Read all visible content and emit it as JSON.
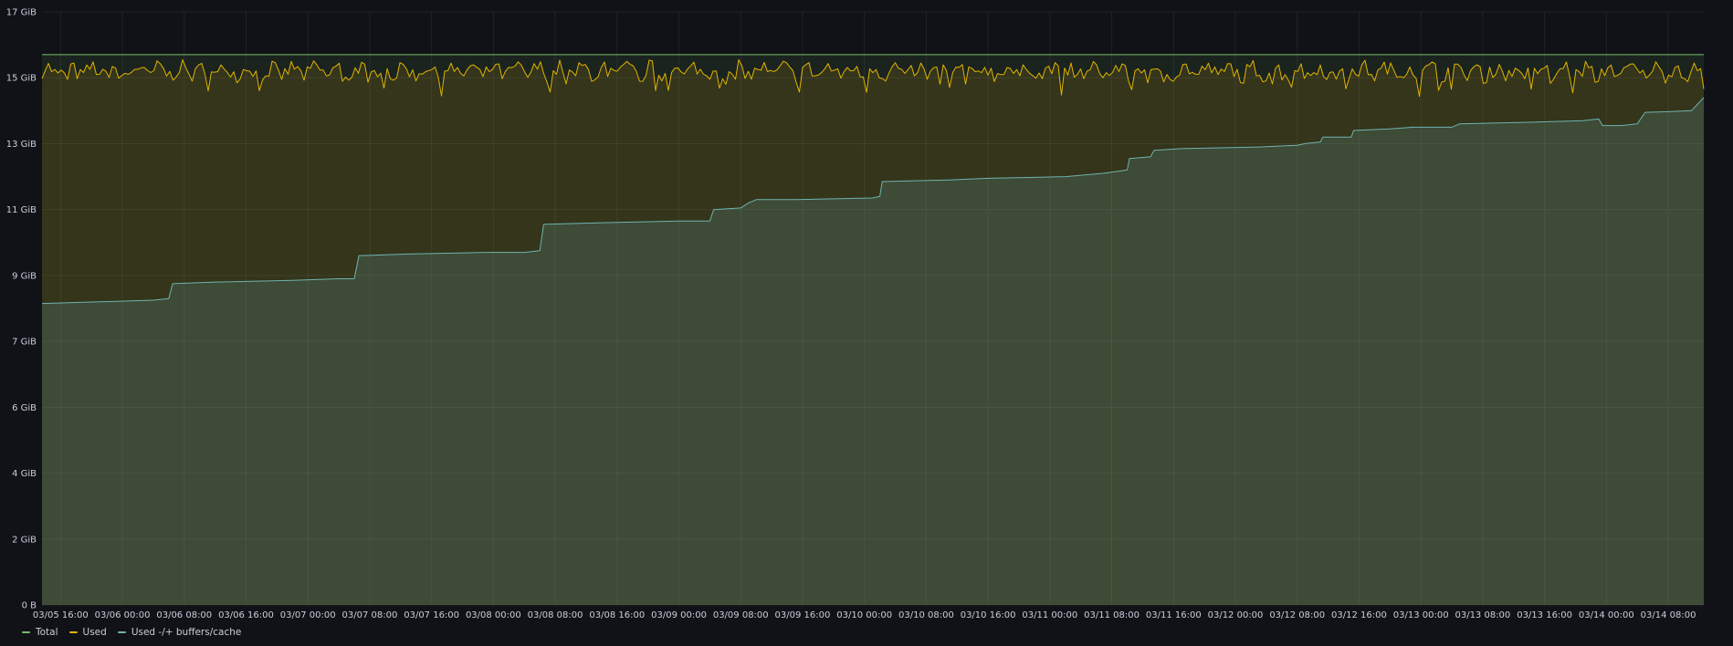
{
  "chart_data": {
    "type": "area",
    "ylim": [
      0,
      17
    ],
    "y_ticks": [
      {
        "label": "0 B",
        "value": 0
      },
      {
        "label": "2 GiB",
        "value": 2
      },
      {
        "label": "4 GiB",
        "value": 4
      },
      {
        "label": "6 GiB",
        "value": 6
      },
      {
        "label": "7 GiB",
        "value": 8
      },
      {
        "label": "9 GiB",
        "value": 10
      },
      {
        "label": "11 GiB",
        "value": 12
      },
      {
        "label": "13 GiB",
        "value": 14
      },
      {
        "label": "15 GiB",
        "value": 16
      },
      {
        "label": "17 GiB",
        "value": 18
      }
    ],
    "x_labels": [
      "03/05 16:00",
      "03/06 00:00",
      "03/06 08:00",
      "03/06 16:00",
      "03/07 00:00",
      "03/07 08:00",
      "03/07 16:00",
      "03/08 00:00",
      "03/08 08:00",
      "03/08 16:00",
      "03/09 00:00",
      "03/09 08:00",
      "03/09 16:00",
      "03/10 00:00",
      "03/10 08:00",
      "03/10 16:00",
      "03/11 00:00",
      "03/11 08:00",
      "03/11 16:00",
      "03/12 00:00",
      "03/12 08:00",
      "03/12 16:00",
      "03/13 00:00",
      "03/13 08:00",
      "03/13 16:00",
      "03/14 00:00",
      "03/14 08:00"
    ],
    "x_start_hours": -2.4,
    "x_end_hours": 212.6,
    "grid": true,
    "legend_position": "bottom-left",
    "series": [
      {
        "name": "Total",
        "color": "#73bf69",
        "fill": "rgba(115,191,105,0.10)",
        "points": [
          [
            -2.4,
            16.7
          ],
          [
            212.6,
            16.7
          ]
        ]
      },
      {
        "name": "Used",
        "color": "#e0b400",
        "fill": "rgba(224,180,0,0.13)",
        "noise_base": 16.2,
        "noise_amp": 0.28,
        "noise_dip": 0.45
      },
      {
        "name": "Used -/+ buffers/cache",
        "color": "#6fb3b0",
        "fill": "rgba(111,179,176,0.18)",
        "points": [
          [
            -2.4,
            9.15
          ],
          [
            5,
            9.2
          ],
          [
            12,
            9.25
          ],
          [
            14,
            9.3
          ],
          [
            14.5,
            9.75
          ],
          [
            20,
            9.8
          ],
          [
            30,
            9.85
          ],
          [
            36,
            9.9
          ],
          [
            38,
            9.9
          ],
          [
            38.6,
            10.6
          ],
          [
            45,
            10.65
          ],
          [
            55,
            10.7
          ],
          [
            60,
            10.7
          ],
          [
            62,
            10.75
          ],
          [
            62.5,
            11.55
          ],
          [
            70,
            11.6
          ],
          [
            80,
            11.65
          ],
          [
            84,
            11.65
          ],
          [
            84.5,
            12.0
          ],
          [
            88,
            12.05
          ],
          [
            89,
            12.2
          ],
          [
            90,
            12.3
          ],
          [
            95,
            12.3
          ],
          [
            105,
            12.35
          ],
          [
            106,
            12.4
          ],
          [
            106.3,
            12.85
          ],
          [
            115,
            12.9
          ],
          [
            120,
            12.95
          ],
          [
            130,
            13.0
          ],
          [
            135,
            13.1
          ],
          [
            138,
            13.2
          ],
          [
            138.3,
            13.55
          ],
          [
            141,
            13.6
          ],
          [
            141.5,
            13.8
          ],
          [
            145,
            13.85
          ],
          [
            155,
            13.9
          ],
          [
            160,
            13.95
          ],
          [
            161,
            14.0
          ],
          [
            163,
            14.05
          ],
          [
            163.3,
            14.2
          ],
          [
            167,
            14.2
          ],
          [
            167.3,
            14.4
          ],
          [
            172,
            14.45
          ],
          [
            175,
            14.5
          ],
          [
            180,
            14.5
          ],
          [
            181,
            14.6
          ],
          [
            190,
            14.65
          ],
          [
            197,
            14.7
          ],
          [
            199,
            14.75
          ],
          [
            199.5,
            14.55
          ],
          [
            202,
            14.55
          ],
          [
            204,
            14.6
          ],
          [
            205,
            14.95
          ],
          [
            208,
            14.97
          ],
          [
            211,
            15.0
          ],
          [
            212.6,
            15.4
          ]
        ]
      }
    ]
  },
  "legend": [
    {
      "label": "Total",
      "color": "#73bf69"
    },
    {
      "label": "Used",
      "color": "#e0b400"
    },
    {
      "label": "Used -/+ buffers/cache",
      "color": "#6fb3b0"
    }
  ]
}
